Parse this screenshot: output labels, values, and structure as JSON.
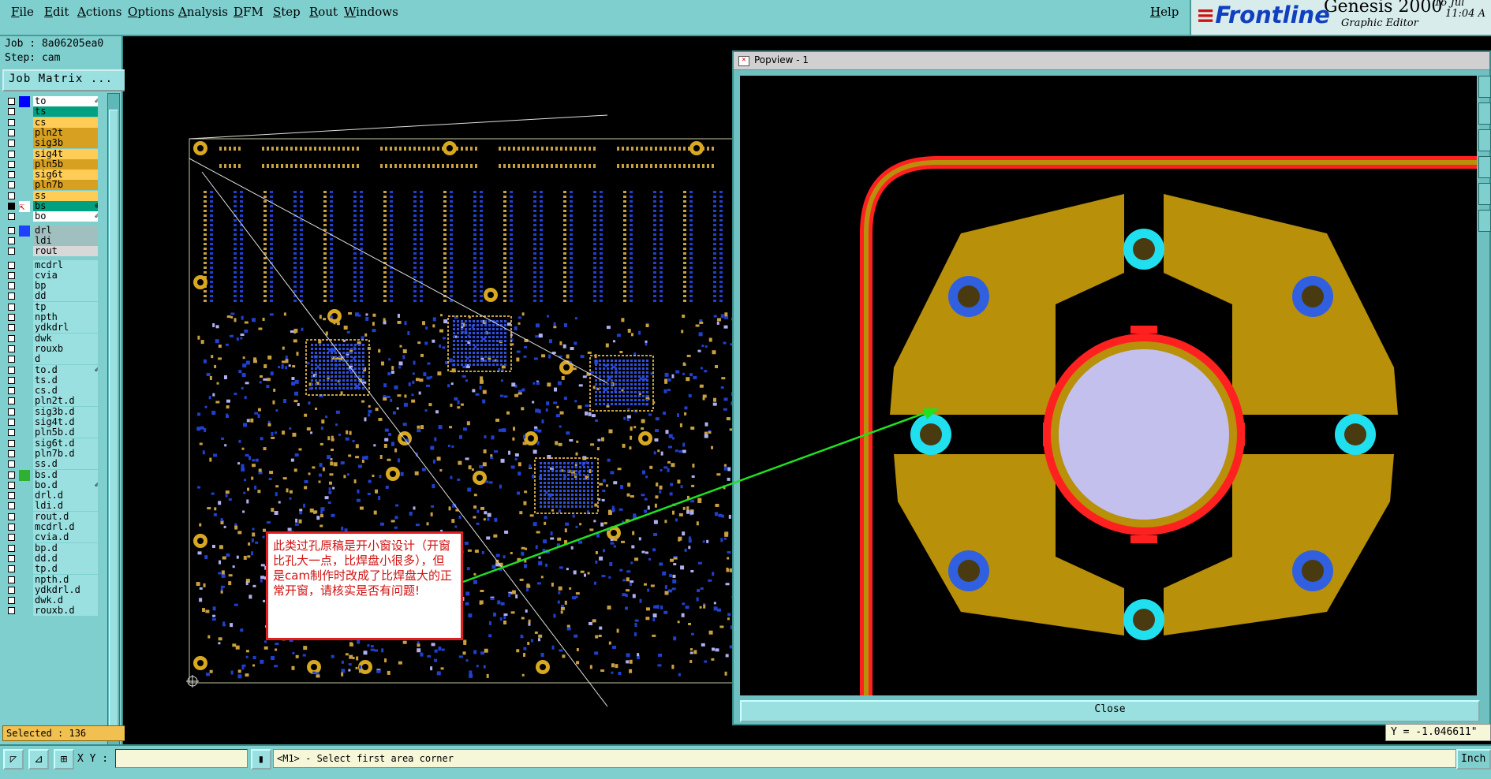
{
  "menu": {
    "items": [
      "File",
      "Edit",
      "Actions",
      "Options",
      "Analysis",
      "DFM",
      "Step",
      "Rout",
      "Windows"
    ],
    "help": "Help"
  },
  "brand": {
    "logo": "Frontline",
    "product": "Genesis 2000",
    "subtitle": "Graphic Editor",
    "date": "16 Jul",
    "time": "11:04 A"
  },
  "job": {
    "job_line": "Job : 8a06205ea0",
    "step_line": "Step: cam",
    "matrix_button": "Job Matrix ..."
  },
  "layers": [
    {
      "name": "to",
      "color": "#ffffff",
      "mark": "✐"
    },
    {
      "name": "ts",
      "color": "#00a080"
    },
    {
      "name": "cs",
      "color": "#ffcc55"
    },
    {
      "name": "pln2t",
      "color": "#d8a020"
    },
    {
      "name": "sig3b",
      "color": "#d8a020"
    },
    {
      "name": "sig4t",
      "color": "#ffcc55"
    },
    {
      "name": "pln5b",
      "color": "#d8a020"
    },
    {
      "name": "sig6t",
      "color": "#ffcc55"
    },
    {
      "name": "pln7b",
      "color": "#d8a020"
    },
    {
      "name": "ss",
      "color": "#ffcc55"
    },
    {
      "name": "bs",
      "color": "#00a080",
      "active": true,
      "mark": "⊕"
    },
    {
      "name": "bo",
      "color": "#ffffff",
      "mark": "✐"
    },
    {
      "name": "drl",
      "color": "#a0c0c0",
      "gap": true
    },
    {
      "name": "ldi",
      "color": "#a0c0c0"
    },
    {
      "name": "rout",
      "color": "#d8d8d8"
    },
    {
      "name": "mcdrl",
      "color": "#9be0e0",
      "gap": true
    },
    {
      "name": "cvia",
      "color": "#9be0e0"
    },
    {
      "name": "bp",
      "color": "#9be0e0"
    },
    {
      "name": "dd",
      "color": "#9be0e0"
    },
    {
      "name": "tp",
      "color": "#9be0e0"
    },
    {
      "name": "npth",
      "color": "#9be0e0"
    },
    {
      "name": "ydkdrl",
      "color": "#9be0e0"
    },
    {
      "name": "dwk",
      "color": "#9be0e0"
    },
    {
      "name": "rouxb",
      "color": "#9be0e0"
    },
    {
      "name": "d",
      "color": "#9be0e0"
    },
    {
      "name": "to.d",
      "color": "#9be0e0",
      "mark": "✐"
    },
    {
      "name": "ts.d",
      "color": "#9be0e0"
    },
    {
      "name": "cs.d",
      "color": "#9be0e0"
    },
    {
      "name": "pln2t.d",
      "color": "#9be0e0"
    },
    {
      "name": "sig3b.d",
      "color": "#9be0e0"
    },
    {
      "name": "sig4t.d",
      "color": "#9be0e0"
    },
    {
      "name": "pln5b.d",
      "color": "#9be0e0"
    },
    {
      "name": "sig6t.d",
      "color": "#9be0e0"
    },
    {
      "name": "pln7b.d",
      "color": "#9be0e0"
    },
    {
      "name": "ss.d",
      "color": "#9be0e0"
    },
    {
      "name": "bs.d",
      "color": "#9be0e0",
      "swatch": "#30b030"
    },
    {
      "name": "bo.d",
      "color": "#9be0e0",
      "mark": "✐"
    },
    {
      "name": "drl.d",
      "color": "#9be0e0"
    },
    {
      "name": "ldi.d",
      "color": "#9be0e0"
    },
    {
      "name": "rout.d",
      "color": "#9be0e0"
    },
    {
      "name": "mcdrl.d",
      "color": "#9be0e0"
    },
    {
      "name": "cvia.d",
      "color": "#9be0e0"
    },
    {
      "name": "bp.d",
      "color": "#9be0e0"
    },
    {
      "name": "dd.d",
      "color": "#9be0e0"
    },
    {
      "name": "tp.d",
      "color": "#9be0e0"
    },
    {
      "name": "npth.d",
      "color": "#9be0e0"
    },
    {
      "name": "ydkdrl.d",
      "color": "#9be0e0"
    },
    {
      "name": "dwk.d",
      "color": "#9be0e0"
    },
    {
      "name": "rouxb.d",
      "color": "#9be0e0"
    }
  ],
  "selected": "Selected : 136",
  "popview": {
    "title": "Popview - 1",
    "close_label": "Close"
  },
  "annotation": "此类过孔原稿是开小窗设计（开窗比孔大一点，比焊盘小很多），但是cam制作时改成了比焊盘大的正常开窗，请核实是否有问题!",
  "coord_y": "Y = -1.046611\"",
  "bottom": {
    "xy_label": "X Y :",
    "xy_value": "",
    "status": "<M1> - Select first area corner",
    "units": "Inch"
  },
  "colors": {
    "panel": "#7fcfcf",
    "copper": "#b8900a",
    "trace_red": "#ff2020",
    "via_blue": "#3060e0",
    "via_cyan": "#20e0f0",
    "drill": "#c0c0f0",
    "pointer_arrow": "#20e020"
  }
}
